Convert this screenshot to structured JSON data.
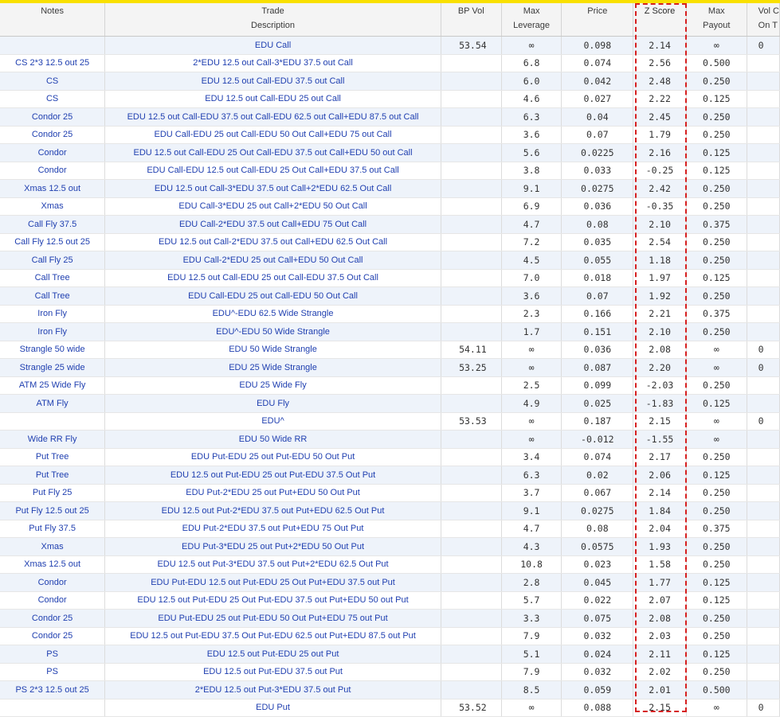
{
  "columns": {
    "notes": "Notes",
    "desc_l1": "Trade",
    "desc_l2": "Description",
    "bpvol": "BP Vol",
    "lev_l1": "Max",
    "lev_l2": "Leverage",
    "price": "Price",
    "z": "Z Score",
    "pay_l1": "Max",
    "pay_l2": "Payout",
    "vol_l1": "Vol C",
    "vol_l2": "On T"
  },
  "highlight": {
    "column": "Z Score",
    "color": "#d62020",
    "style": "dashed"
  },
  "rows": [
    {
      "notes": "",
      "desc": "EDU Call",
      "bp": "53.54",
      "lev": "∞",
      "price": "0.098",
      "z": "2.14",
      "pay": "∞",
      "vol": "0"
    },
    {
      "notes": "CS 2*3 12.5 out 25",
      "desc": "2*EDU 12.5 out Call-3*EDU 37.5 out Call",
      "bp": "",
      "lev": "6.8",
      "price": "0.074",
      "z": "2.56",
      "pay": "0.500",
      "vol": ""
    },
    {
      "notes": "CS",
      "desc": "EDU 12.5 out Call-EDU 37.5 out Call",
      "bp": "",
      "lev": "6.0",
      "price": "0.042",
      "z": "2.48",
      "pay": "0.250",
      "vol": ""
    },
    {
      "notes": "CS",
      "desc": "EDU 12.5 out Call-EDU 25 out Call",
      "bp": "",
      "lev": "4.6",
      "price": "0.027",
      "z": "2.22",
      "pay": "0.125",
      "vol": ""
    },
    {
      "notes": "Condor 25",
      "desc": "EDU 12.5 out Call-EDU 37.5 out Call-EDU 62.5 out Call+EDU 87.5 out Call",
      "bp": "",
      "lev": "6.3",
      "price": "0.04",
      "z": "2.45",
      "pay": "0.250",
      "vol": ""
    },
    {
      "notes": "Condor 25",
      "desc": "EDU Call-EDU 25 out Call-EDU 50 Out Call+EDU 75 out Call",
      "bp": "",
      "lev": "3.6",
      "price": "0.07",
      "z": "1.79",
      "pay": "0.250",
      "vol": ""
    },
    {
      "notes": "Condor",
      "desc": "EDU 12.5 out Call-EDU 25 Out Call-EDU 37.5 out Call+EDU 50 out Call",
      "bp": "",
      "lev": "5.6",
      "price": "0.0225",
      "z": "2.16",
      "pay": "0.125",
      "vol": ""
    },
    {
      "notes": "Condor",
      "desc": "EDU Call-EDU 12.5 out Call-EDU 25 Out Call+EDU 37.5 out Call",
      "bp": "",
      "lev": "3.8",
      "price": "0.033",
      "z": "-0.25",
      "pay": "0.125",
      "vol": ""
    },
    {
      "notes": "Xmas 12.5 out",
      "desc": "EDU 12.5 out Call-3*EDU 37.5 out Call+2*EDU 62.5 Out Call",
      "bp": "",
      "lev": "9.1",
      "price": "0.0275",
      "z": "2.42",
      "pay": "0.250",
      "vol": ""
    },
    {
      "notes": "Xmas",
      "desc": "EDU Call-3*EDU 25 out Call+2*EDU 50 Out Call",
      "bp": "",
      "lev": "6.9",
      "price": "0.036",
      "z": "-0.35",
      "pay": "0.250",
      "vol": ""
    },
    {
      "notes": "Call Fly 37.5",
      "desc": "EDU Call-2*EDU 37.5 out Call+EDU 75 Out Call",
      "bp": "",
      "lev": "4.7",
      "price": "0.08",
      "z": "2.10",
      "pay": "0.375",
      "vol": ""
    },
    {
      "notes": "Call Fly 12.5 out 25",
      "desc": "EDU 12.5 out Call-2*EDU 37.5 out Call+EDU 62.5 Out Call",
      "bp": "",
      "lev": "7.2",
      "price": "0.035",
      "z": "2.54",
      "pay": "0.250",
      "vol": ""
    },
    {
      "notes": "Call Fly 25",
      "desc": "EDU Call-2*EDU 25 out Call+EDU 50 Out Call",
      "bp": "",
      "lev": "4.5",
      "price": "0.055",
      "z": "1.18",
      "pay": "0.250",
      "vol": ""
    },
    {
      "notes": "Call Tree",
      "desc": "EDU 12.5 out Call-EDU 25 out Call-EDU 37.5 Out Call",
      "bp": "",
      "lev": "7.0",
      "price": "0.018",
      "z": "1.97",
      "pay": "0.125",
      "vol": ""
    },
    {
      "notes": "Call Tree",
      "desc": "EDU Call-EDU 25 out Call-EDU 50 Out Call",
      "bp": "",
      "lev": "3.6",
      "price": "0.07",
      "z": "1.92",
      "pay": "0.250",
      "vol": ""
    },
    {
      "notes": "Iron Fly",
      "desc": "EDU^-EDU 62.5 Wide Strangle",
      "bp": "",
      "lev": "2.3",
      "price": "0.166",
      "z": "2.21",
      "pay": "0.375",
      "vol": ""
    },
    {
      "notes": "Iron Fly",
      "desc": "EDU^-EDU 50 Wide Strangle",
      "bp": "",
      "lev": "1.7",
      "price": "0.151",
      "z": "2.10",
      "pay": "0.250",
      "vol": ""
    },
    {
      "notes": "Strangle 50 wide",
      "desc": "EDU 50 Wide Strangle",
      "bp": "54.11",
      "lev": "∞",
      "price": "0.036",
      "z": "2.08",
      "pay": "∞",
      "vol": "0"
    },
    {
      "notes": "Strangle 25 wide",
      "desc": "EDU 25 Wide Strangle",
      "bp": "53.25",
      "lev": "∞",
      "price": "0.087",
      "z": "2.20",
      "pay": "∞",
      "vol": "0"
    },
    {
      "notes": "ATM 25 Wide Fly",
      "desc": "EDU 25 Wide Fly",
      "bp": "",
      "lev": "2.5",
      "price": "0.099",
      "z": "-2.03",
      "pay": "0.250",
      "vol": ""
    },
    {
      "notes": "ATM Fly",
      "desc": "EDU Fly",
      "bp": "",
      "lev": "4.9",
      "price": "0.025",
      "z": "-1.83",
      "pay": "0.125",
      "vol": ""
    },
    {
      "notes": "",
      "desc": "EDU^",
      "bp": "53.53",
      "lev": "∞",
      "price": "0.187",
      "z": "2.15",
      "pay": "∞",
      "vol": "0"
    },
    {
      "notes": "Wide RR Fly",
      "desc": "EDU 50 Wide RR",
      "bp": "",
      "lev": "∞",
      "price": "-0.012",
      "z": "-1.55",
      "pay": "∞",
      "vol": ""
    },
    {
      "notes": "Put Tree",
      "desc": "EDU Put-EDU 25 out Put-EDU 50 Out Put",
      "bp": "",
      "lev": "3.4",
      "price": "0.074",
      "z": "2.17",
      "pay": "0.250",
      "vol": ""
    },
    {
      "notes": "Put Tree",
      "desc": "EDU 12.5 out Put-EDU 25 out Put-EDU 37.5 Out Put",
      "bp": "",
      "lev": "6.3",
      "price": "0.02",
      "z": "2.06",
      "pay": "0.125",
      "vol": ""
    },
    {
      "notes": "Put Fly 25",
      "desc": "EDU Put-2*EDU 25 out Put+EDU 50 Out Put",
      "bp": "",
      "lev": "3.7",
      "price": "0.067",
      "z": "2.14",
      "pay": "0.250",
      "vol": ""
    },
    {
      "notes": "Put Fly 12.5 out 25",
      "desc": "EDU 12.5 out Put-2*EDU 37.5 out Put+EDU 62.5 Out Put",
      "bp": "",
      "lev": "9.1",
      "price": "0.0275",
      "z": "1.84",
      "pay": "0.250",
      "vol": ""
    },
    {
      "notes": "Put Fly 37.5",
      "desc": "EDU Put-2*EDU 37.5 out Put+EDU 75 Out Put",
      "bp": "",
      "lev": "4.7",
      "price": "0.08",
      "z": "2.04",
      "pay": "0.375",
      "vol": ""
    },
    {
      "notes": "Xmas",
      "desc": "EDU Put-3*EDU 25 out Put+2*EDU 50 Out Put",
      "bp": "",
      "lev": "4.3",
      "price": "0.0575",
      "z": "1.93",
      "pay": "0.250",
      "vol": ""
    },
    {
      "notes": "Xmas 12.5 out",
      "desc": "EDU 12.5 out Put-3*EDU 37.5 out Put+2*EDU 62.5 Out Put",
      "bp": "",
      "lev": "10.8",
      "price": "0.023",
      "z": "1.58",
      "pay": "0.250",
      "vol": ""
    },
    {
      "notes": "Condor",
      "desc": "EDU Put-EDU 12.5 out Put-EDU 25 Out Put+EDU 37.5 out Put",
      "bp": "",
      "lev": "2.8",
      "price": "0.045",
      "z": "1.77",
      "pay": "0.125",
      "vol": ""
    },
    {
      "notes": "Condor",
      "desc": "EDU 12.5 out Put-EDU 25 Out Put-EDU 37.5 out Put+EDU 50 out Put",
      "bp": "",
      "lev": "5.7",
      "price": "0.022",
      "z": "2.07",
      "pay": "0.125",
      "vol": ""
    },
    {
      "notes": "Condor 25",
      "desc": "EDU Put-EDU 25 out Put-EDU 50 Out Put+EDU 75 out Put",
      "bp": "",
      "lev": "3.3",
      "price": "0.075",
      "z": "2.08",
      "pay": "0.250",
      "vol": ""
    },
    {
      "notes": "Condor 25",
      "desc": "EDU 12.5 out Put-EDU 37.5 Out Put-EDU 62.5 out Put+EDU 87.5 out Put",
      "bp": "",
      "lev": "7.9",
      "price": "0.032",
      "z": "2.03",
      "pay": "0.250",
      "vol": ""
    },
    {
      "notes": "PS",
      "desc": "EDU 12.5 out Put-EDU 25 out Put",
      "bp": "",
      "lev": "5.1",
      "price": "0.024",
      "z": "2.11",
      "pay": "0.125",
      "vol": ""
    },
    {
      "notes": "PS",
      "desc": "EDU 12.5 out Put-EDU 37.5 out Put",
      "bp": "",
      "lev": "7.9",
      "price": "0.032",
      "z": "2.02",
      "pay": "0.250",
      "vol": ""
    },
    {
      "notes": "PS 2*3 12.5 out 25",
      "desc": "2*EDU 12.5 out Put-3*EDU 37.5 out Put",
      "bp": "",
      "lev": "8.5",
      "price": "0.059",
      "z": "2.01",
      "pay": "0.500",
      "vol": ""
    },
    {
      "notes": "",
      "desc": "EDU Put",
      "bp": "53.52",
      "lev": "∞",
      "price": "0.088",
      "z": "2.15",
      "pay": "∞",
      "vol": "0"
    }
  ]
}
